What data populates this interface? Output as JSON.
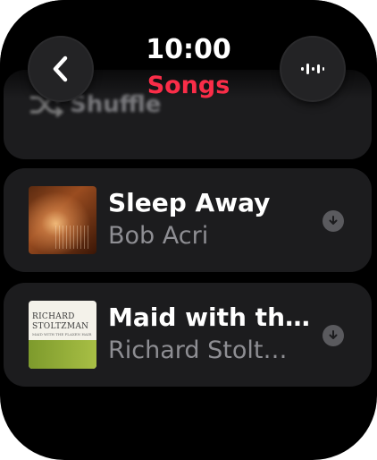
{
  "status": {
    "time": "10:00"
  },
  "header": {
    "title": "Songs"
  },
  "shuffle": {
    "label": "Shuffle"
  },
  "songs": [
    {
      "title": "Sleep Away",
      "artist": "Bob Acri"
    },
    {
      "title": "Maid with th…",
      "artist": "Richard Stolt…",
      "art_text": [
        "RICHARD",
        "STOLTZMAN",
        "MAID WITH THE FLAXEN HAIR"
      ]
    }
  ],
  "colors": {
    "accent": "#fa2d48",
    "background": "#000000",
    "row": "#1c1c1e",
    "secondary_text": "#8e8e93"
  },
  "icons": {
    "back": "chevron-left-icon",
    "now_playing": "waveform-icon",
    "shuffle": "shuffle-icon",
    "download": "download-icon"
  }
}
